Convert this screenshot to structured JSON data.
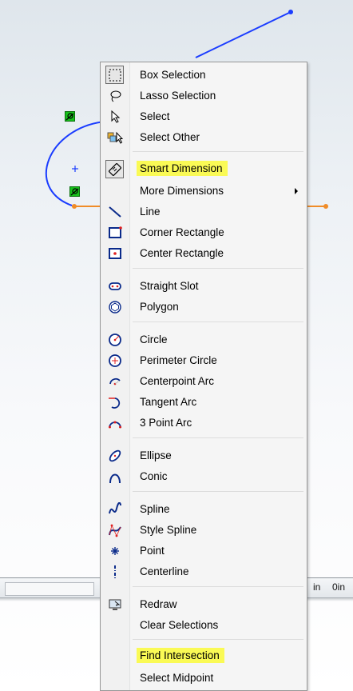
{
  "status_bar": {
    "value_left": "in",
    "value_right": "0in"
  },
  "menu": {
    "items": [
      {
        "label": "Box Selection",
        "icon": "box-selection-icon"
      },
      {
        "label": "Lasso Selection",
        "icon": "lasso-icon"
      },
      {
        "label": "Select",
        "icon": "select-arrow-icon"
      },
      {
        "label": "Select Other",
        "icon": "select-other-icon"
      },
      {
        "label": "Smart Dimension",
        "icon": "smart-dimension-icon"
      },
      {
        "label": "More Dimensions",
        "icon": "none"
      },
      {
        "label": "Line",
        "icon": "line-icon"
      },
      {
        "label": "Corner Rectangle",
        "icon": "corner-rectangle-icon"
      },
      {
        "label": "Center Rectangle",
        "icon": "center-rectangle-icon"
      },
      {
        "label": "Straight Slot",
        "icon": "straight-slot-icon"
      },
      {
        "label": "Polygon",
        "icon": "polygon-icon"
      },
      {
        "label": "Circle",
        "icon": "circle-icon"
      },
      {
        "label": "Perimeter Circle",
        "icon": "perimeter-circle-icon"
      },
      {
        "label": "Centerpoint Arc",
        "icon": "centerpoint-arc-icon"
      },
      {
        "label": "Tangent Arc",
        "icon": "tangent-arc-icon"
      },
      {
        "label": "3 Point Arc",
        "icon": "three-point-arc-icon"
      },
      {
        "label": "Ellipse",
        "icon": "ellipse-icon"
      },
      {
        "label": "Conic",
        "icon": "conic-icon"
      },
      {
        "label": "Spline",
        "icon": "spline-icon"
      },
      {
        "label": "Style Spline",
        "icon": "style-spline-icon"
      },
      {
        "label": "Point",
        "icon": "point-icon"
      },
      {
        "label": "Centerline",
        "icon": "centerline-icon"
      },
      {
        "label": "Redraw",
        "icon": "redraw-icon"
      },
      {
        "label": "Clear Selections",
        "icon": "none"
      },
      {
        "label": "Find Intersection",
        "icon": "none"
      },
      {
        "label": "Select Midpoint",
        "icon": "none"
      }
    ]
  },
  "colors": {
    "highlight": "#fafa55",
    "sketch_line": "#1a3cff",
    "construction_orange": "#f08c28",
    "relation_green": "#17c11b"
  }
}
